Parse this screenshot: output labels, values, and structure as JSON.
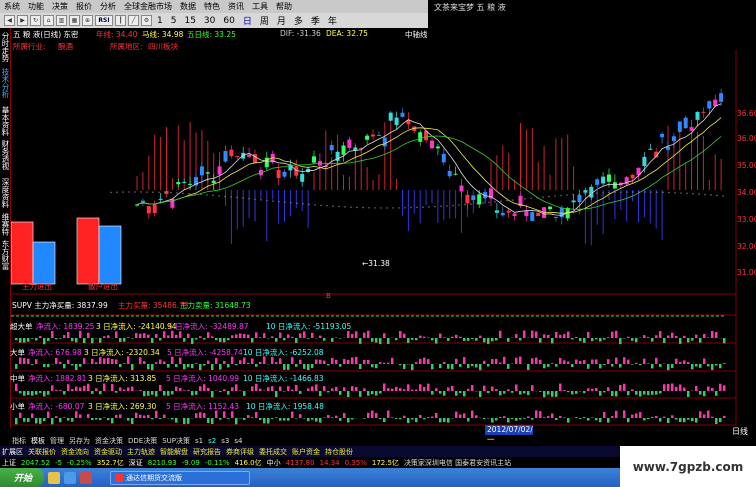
{
  "menu": {
    "items": [
      "系统",
      "功能",
      "决策",
      "报价",
      "分析",
      "全球金融市场",
      "数据",
      "特色",
      "资讯",
      "工具",
      "帮助"
    ],
    "title_right": "文茶来宝梦 五 粮 液"
  },
  "toolbar": {
    "periods": [
      "1",
      "5",
      "15",
      "30",
      "60",
      "日",
      "周",
      "月",
      "多",
      "季",
      "年"
    ],
    "label_tick": "RSI",
    "right_label": "中轴线"
  },
  "left_tabs": [
    "分时走势",
    "技术分析",
    "基本资料",
    "财务透视",
    "深度资料",
    "维赛特",
    "东方财富"
  ],
  "info": {
    "stock": "五 粮 液(日线) 东密",
    "ma1": "年线: 34.40",
    "ma2": "马线: 34.98",
    "ma3": "五日线: 33.25",
    "dif": "DIF: -31.36",
    "dea": "DEA: 32.75",
    "industry_label": "所属行业:",
    "industry_value": "酿酒",
    "region_label": "所属地区:",
    "region_value": "四川板块"
  },
  "price_axis": [
    "36.60",
    "36.00",
    "35.00",
    "34.00",
    "33.00",
    "32.00",
    "31.00"
  ],
  "labels": {
    "main_in": "主力进出",
    "retail_in": "散户进出",
    "low_marker": "←31.38",
    "selected_date": "2012/07/02/一",
    "day_selector": "日线",
    "marker_b": "B"
  },
  "supv": {
    "title": "SUPV 主力净买量: 3837.99",
    "buy": "主力买量: 35486.73",
    "sell": "主力卖量: 31648.73"
  },
  "panels": [
    {
      "name": "超大单",
      "n1": "净流入: 1839.25",
      "n3": "3 日净流入: -24140.94",
      "n5": "5 日净流入: -32489.87",
      "n10": "10 日净流入: -51193.05"
    },
    {
      "name": "大单",
      "n1": "净流入: 676.98",
      "n3": "3 日净流入: -2320.34",
      "n5": "5 日净流入: -4258.74",
      "n10": "10 日净流入: -6252.08"
    },
    {
      "name": "中单",
      "n1": "净流入: 1882.81",
      "n3": "3 日净流入: 313.85",
      "n5": "5 日净流入: 1040.99",
      "n10": "10 日净流入: -1466.83"
    },
    {
      "name": "小单",
      "n1": "净流入: -680.07",
      "n3": "3 日净流入: 269.30",
      "n5": "5 日净流入: 1152.43",
      "n10": "10 日净流入: 1958.48"
    }
  ],
  "bottom_tabs": [
    "指标",
    "模板",
    "管理",
    "另存为",
    "资金决策",
    "DDE决策",
    "SUP决策",
    "s1",
    "s2",
    "s3",
    "s4"
  ],
  "nav": [
    "扩展区",
    "关联报价",
    "资金流向",
    "资金驱动",
    "主力轨迹",
    "智能解盘",
    "研究报告",
    "券商评级",
    "委托成交",
    "账户资金",
    "持仓股份"
  ],
  "status": {
    "sh_label": "上证",
    "sh_value": "2047.52",
    "sh_change": "-5",
    "sh_pct": "-0.25%",
    "sh_amount": "352.7亿",
    "sz_label": "深证",
    "sz_value": "8210.93",
    "sz_change": "-9.09",
    "sz_pct": "-0.11%",
    "sz_amount": "416.0亿",
    "zx_label": "中小",
    "zx_value": "4137.80",
    "zx_change": "14.34",
    "zx_pct": "0.35%",
    "zx_amount": "172.5亿",
    "news": "决策家深圳电信 国泰君安资讯主站"
  },
  "taskbar": {
    "start": "开始",
    "item": "通达信期货交流版"
  },
  "watermark": "www.7gpzb.com",
  "colors": {
    "up": "#ff2a2a",
    "down": "#3a5cff",
    "cyan": "#33dddd",
    "magenta": "#ff33cc",
    "green": "#33ff33",
    "yellow": "#ffff44",
    "label_red": "#ff3333"
  }
}
